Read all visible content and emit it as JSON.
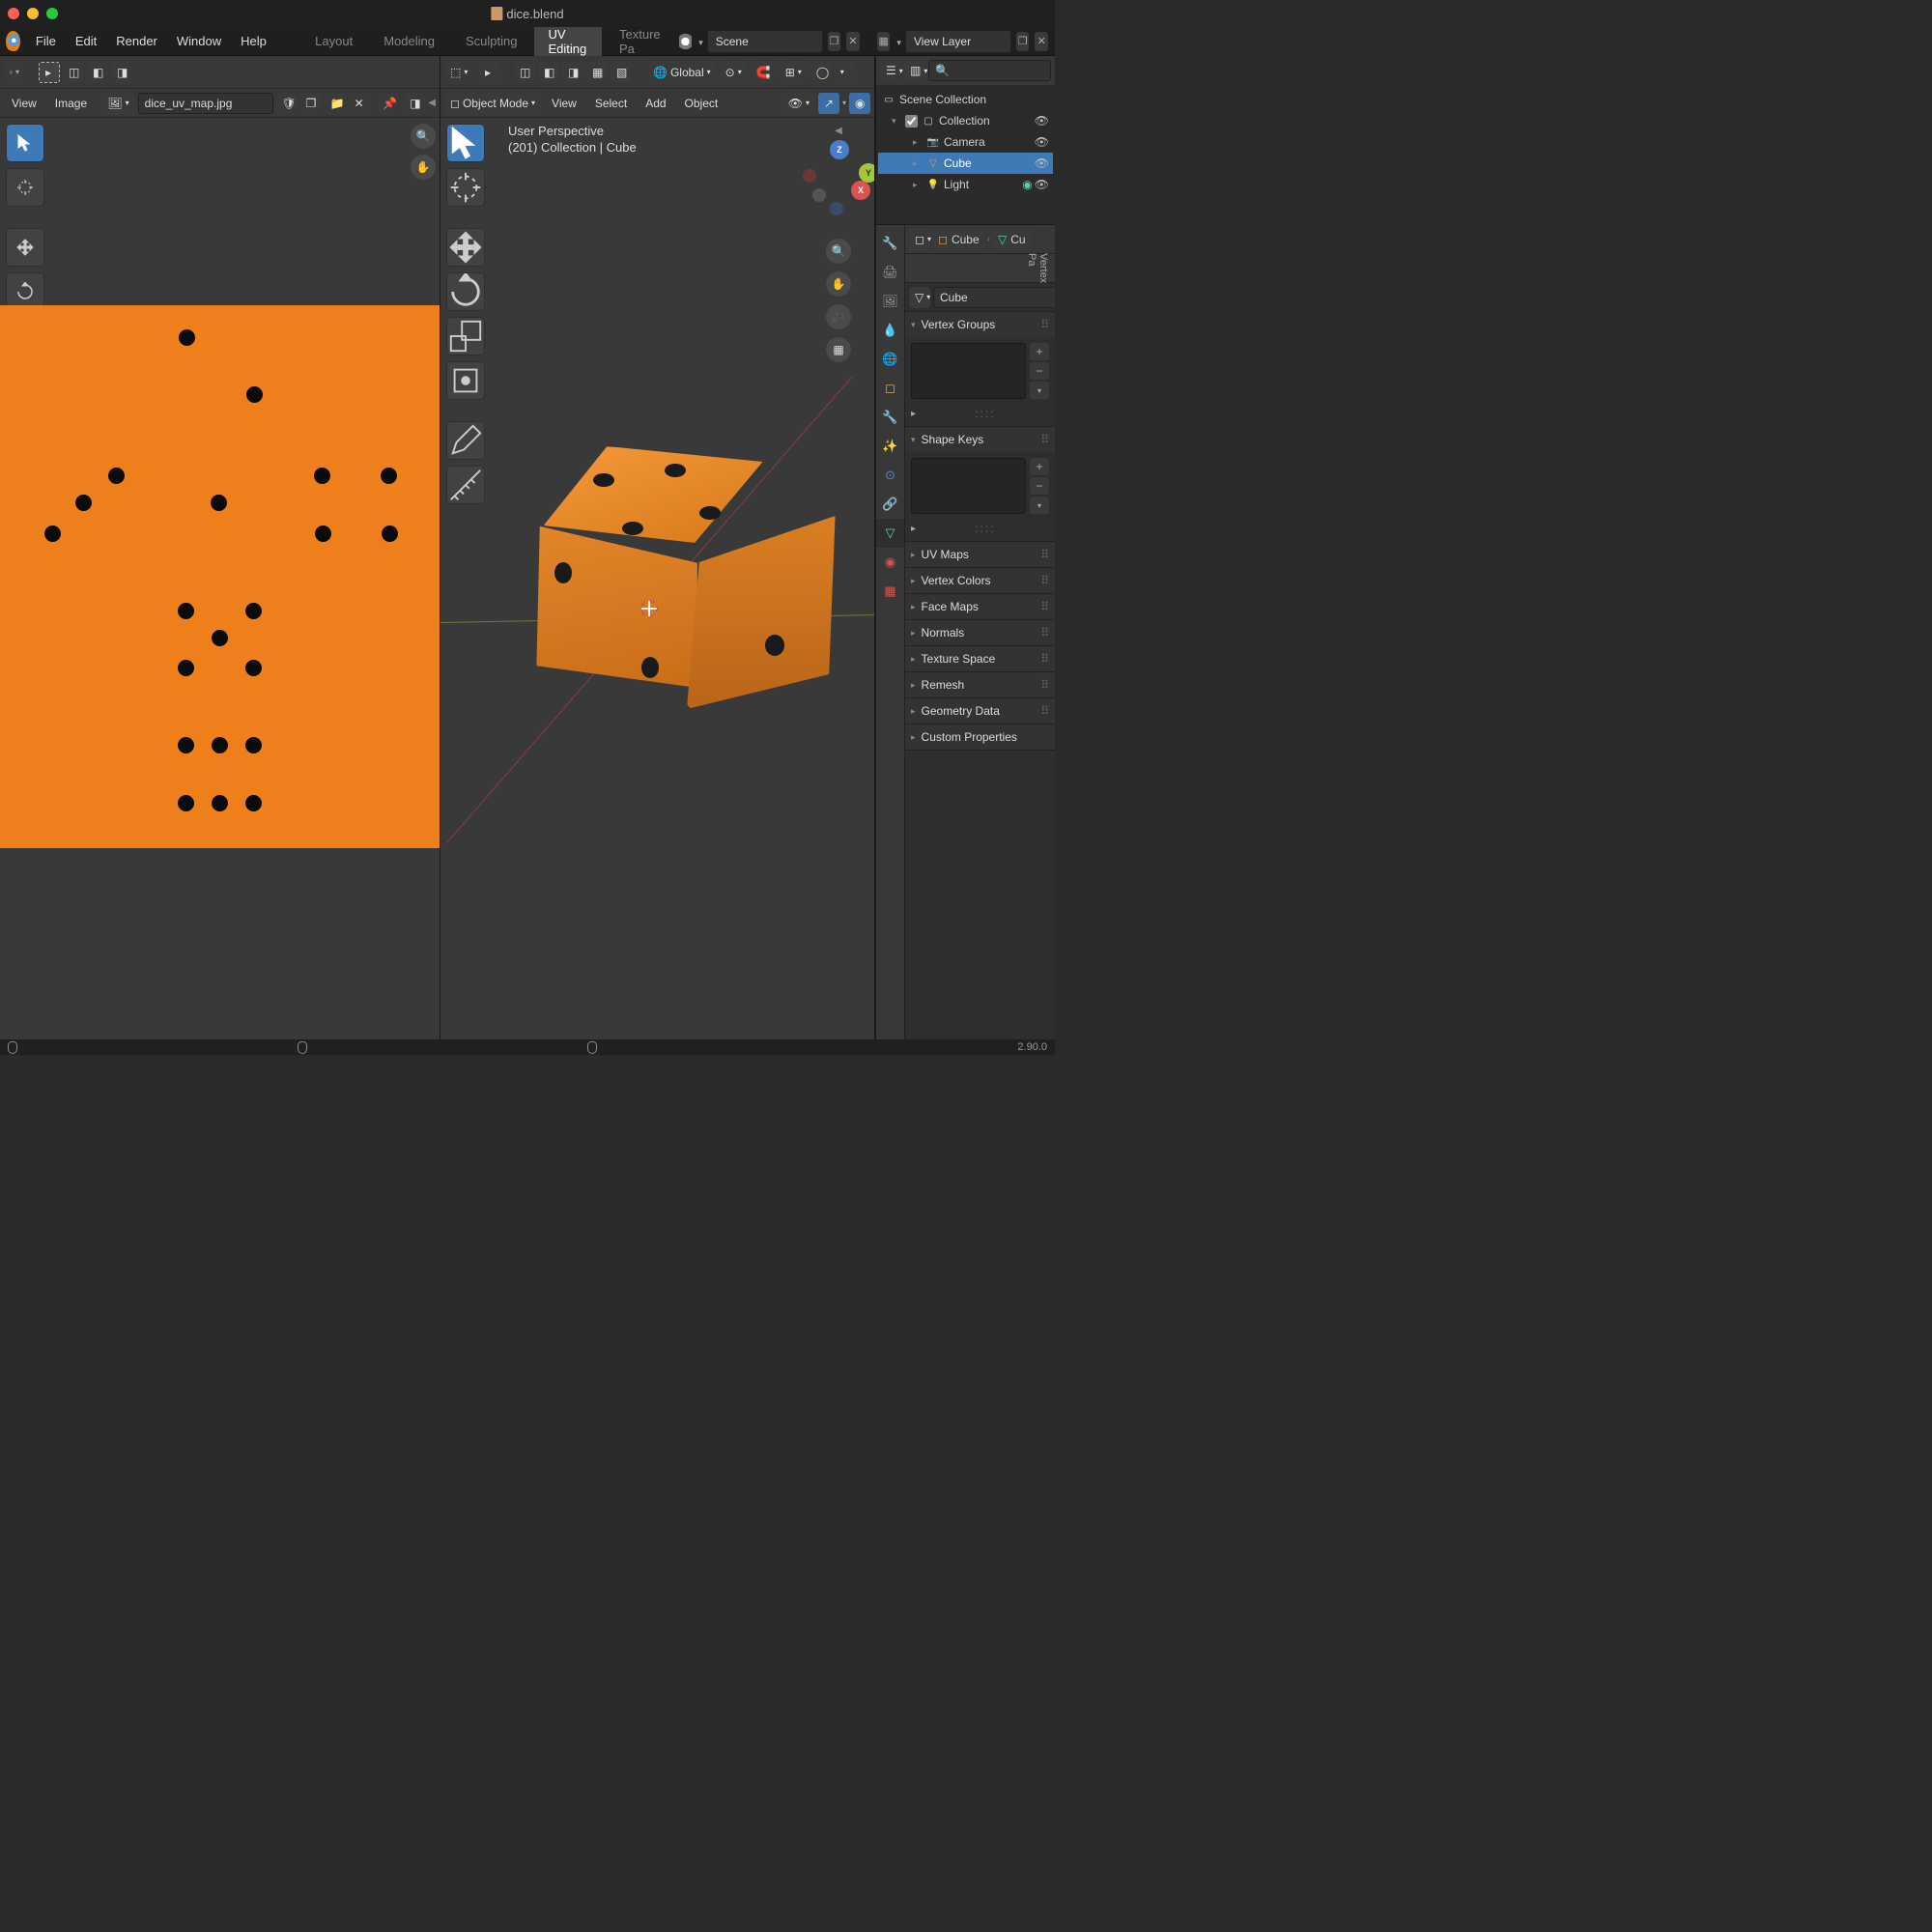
{
  "window": {
    "title": "dice.blend"
  },
  "menus": {
    "file": "File",
    "edit": "Edit",
    "render": "Render",
    "window": "Window",
    "help": "Help"
  },
  "tabs": {
    "layout": "Layout",
    "modeling": "Modeling",
    "sculpting": "Sculpting",
    "uv": "UV Editing",
    "texture": "Texture Pa"
  },
  "scene": {
    "name": "Scene",
    "layer": "View Layer"
  },
  "uv": {
    "menus": {
      "view": "View",
      "image": "Image"
    },
    "image_name": "dice_uv_map.jpg"
  },
  "viewport": {
    "mode": "Object Mode",
    "menus": {
      "view": "View",
      "select": "Select",
      "add": "Add",
      "object": "Object"
    },
    "orientation": "Global",
    "info": {
      "persp": "User Perspective",
      "coll": "(201) Collection | Cube"
    },
    "gizmo": {
      "x": "X",
      "y": "Y",
      "z": "Z"
    }
  },
  "outliner": {
    "root": "Scene Collection",
    "collection": "Collection",
    "items": [
      {
        "name": "Camera",
        "icon": "camera"
      },
      {
        "name": "Cube",
        "icon": "mesh"
      },
      {
        "name": "Light",
        "icon": "light"
      }
    ]
  },
  "props": {
    "crumb_obj": "Cube",
    "crumb_data": "Cu",
    "obj_name": "Cube",
    "panels": {
      "vertex_groups": "Vertex Groups",
      "shape_keys": "Shape Keys",
      "uv_maps": "UV Maps",
      "vertex_colors": "Vertex Colors",
      "face_maps": "Face Maps",
      "normals": "Normals",
      "tex_space": "Texture Space",
      "remesh": "Remesh",
      "geom": "Geometry Data",
      "custom": "Custom Properties"
    },
    "vertex_pa": "Vertex Pa"
  },
  "status": {
    "version": "2.90.0"
  }
}
